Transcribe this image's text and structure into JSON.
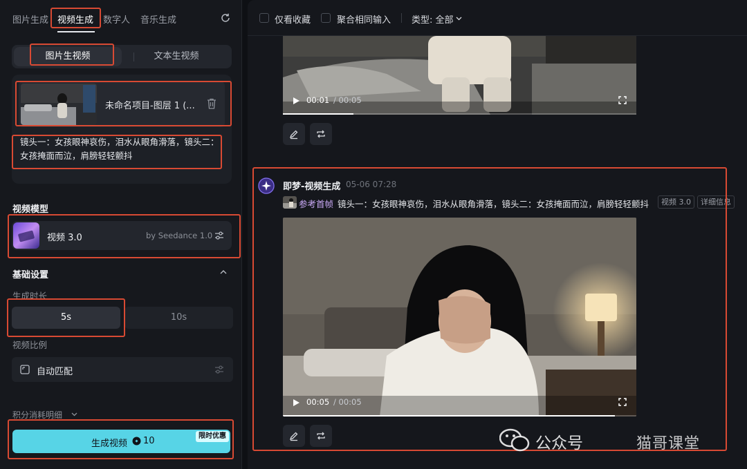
{
  "left_tabs": [
    "图片生成",
    "视频生成",
    "数字人",
    "音乐生成"
  ],
  "mode_segment": {
    "active": "图片生视频",
    "other": "文本生视频"
  },
  "upload": {
    "filename": "未命名项目-图层 1 (...",
    "prompt": "镜头一：女孩眼神哀伤，泪水从眼角滑落，镜头二：女孩掩面而泣，肩膀轻轻颤抖"
  },
  "model": {
    "section_title": "视频模型",
    "name": "视频 3.0",
    "by": "by Seedance 1.0"
  },
  "basic_settings": {
    "title": "基础设置",
    "duration_label": "生成时长",
    "durations": [
      "5s",
      "10s"
    ],
    "active_duration": "5s",
    "ratio_label": "视频比例",
    "ratio_value": "自动匹配"
  },
  "points_detail": "积分消耗明细",
  "generate": {
    "label": "生成视频",
    "cost": "10",
    "promo": "限时优惠",
    "color": "#57d4e6"
  },
  "filters": {
    "favorites_only": "仅看收藏",
    "merge_same_input": "聚合相同输入",
    "type_label": "类型: 全部"
  },
  "video1": {
    "current_time": "00:01",
    "total_time": "/ 00:05",
    "progress": 0.2
  },
  "post": {
    "author": "即梦-视频生成",
    "date": "05-06  07:28",
    "ref_label": "参考首帧",
    "description": "镜头一：女孩眼神哀伤，泪水从眼角滑落，镜头二：女孩掩面而泣，肩膀轻轻颤抖",
    "tag_model": "视频 3.0",
    "tag_detail": "详细信息"
  },
  "video2": {
    "current_time": "00:05",
    "total_time": "/ 00:05",
    "progress": 1.0
  },
  "watermark": {
    "text": "公众号",
    "brand": "猫哥课堂"
  },
  "accent_colors": {
    "annotation": "#d94a33",
    "avatar": "#3b2d86"
  }
}
